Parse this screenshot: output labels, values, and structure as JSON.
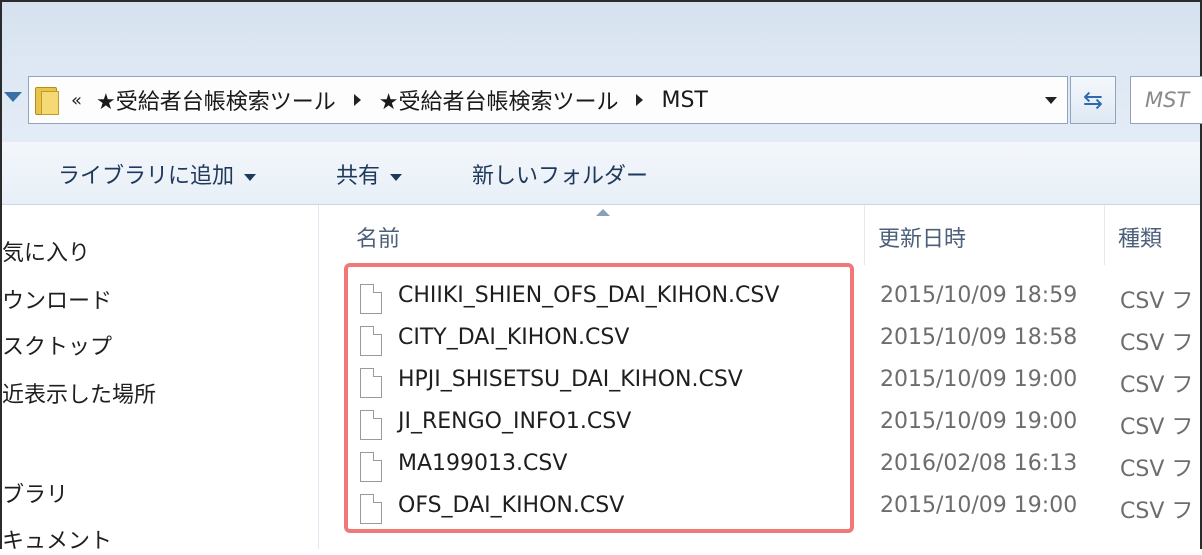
{
  "address": {
    "overflow": "«",
    "crumbs": [
      "★受給者台帳検索ツール",
      "★受給者台帳検索ツール",
      "MST"
    ]
  },
  "search": {
    "placeholder": "MST"
  },
  "toolbar": {
    "add_to_library": "ライブラリに追加",
    "share": "共有",
    "new_folder": "新しいフォルダー"
  },
  "nav": {
    "items": [
      "気に入り",
      "ウンロード",
      "スクトップ",
      "近表示した場所",
      "ブラリ",
      "キュメント"
    ]
  },
  "columns": {
    "name": "名前",
    "date": "更新日時",
    "type": "種類"
  },
  "files": [
    {
      "name": "CHIIKI_SHIEN_OFS_DAI_KIHON.CSV",
      "date": "2015/10/09 18:59",
      "type": "CSV フ"
    },
    {
      "name": "CITY_DAI_KIHON.CSV",
      "date": "2015/10/09 18:58",
      "type": "CSV フ"
    },
    {
      "name": "HPJI_SHISETSU_DAI_KIHON.CSV",
      "date": "2015/10/09 19:00",
      "type": "CSV フ"
    },
    {
      "name": "JI_RENGO_INFO1.CSV",
      "date": "2015/10/09 19:00",
      "type": "CSV フ"
    },
    {
      "name": "MA199013.CSV",
      "date": "2016/02/08 16:13",
      "type": "CSV フ"
    },
    {
      "name": "OFS_DAI_KIHON.CSV",
      "date": "2015/10/09 19:00",
      "type": "CSV フ"
    }
  ],
  "colors": {
    "highlight": "#f07878",
    "toolbar_text": "#1e395b"
  }
}
